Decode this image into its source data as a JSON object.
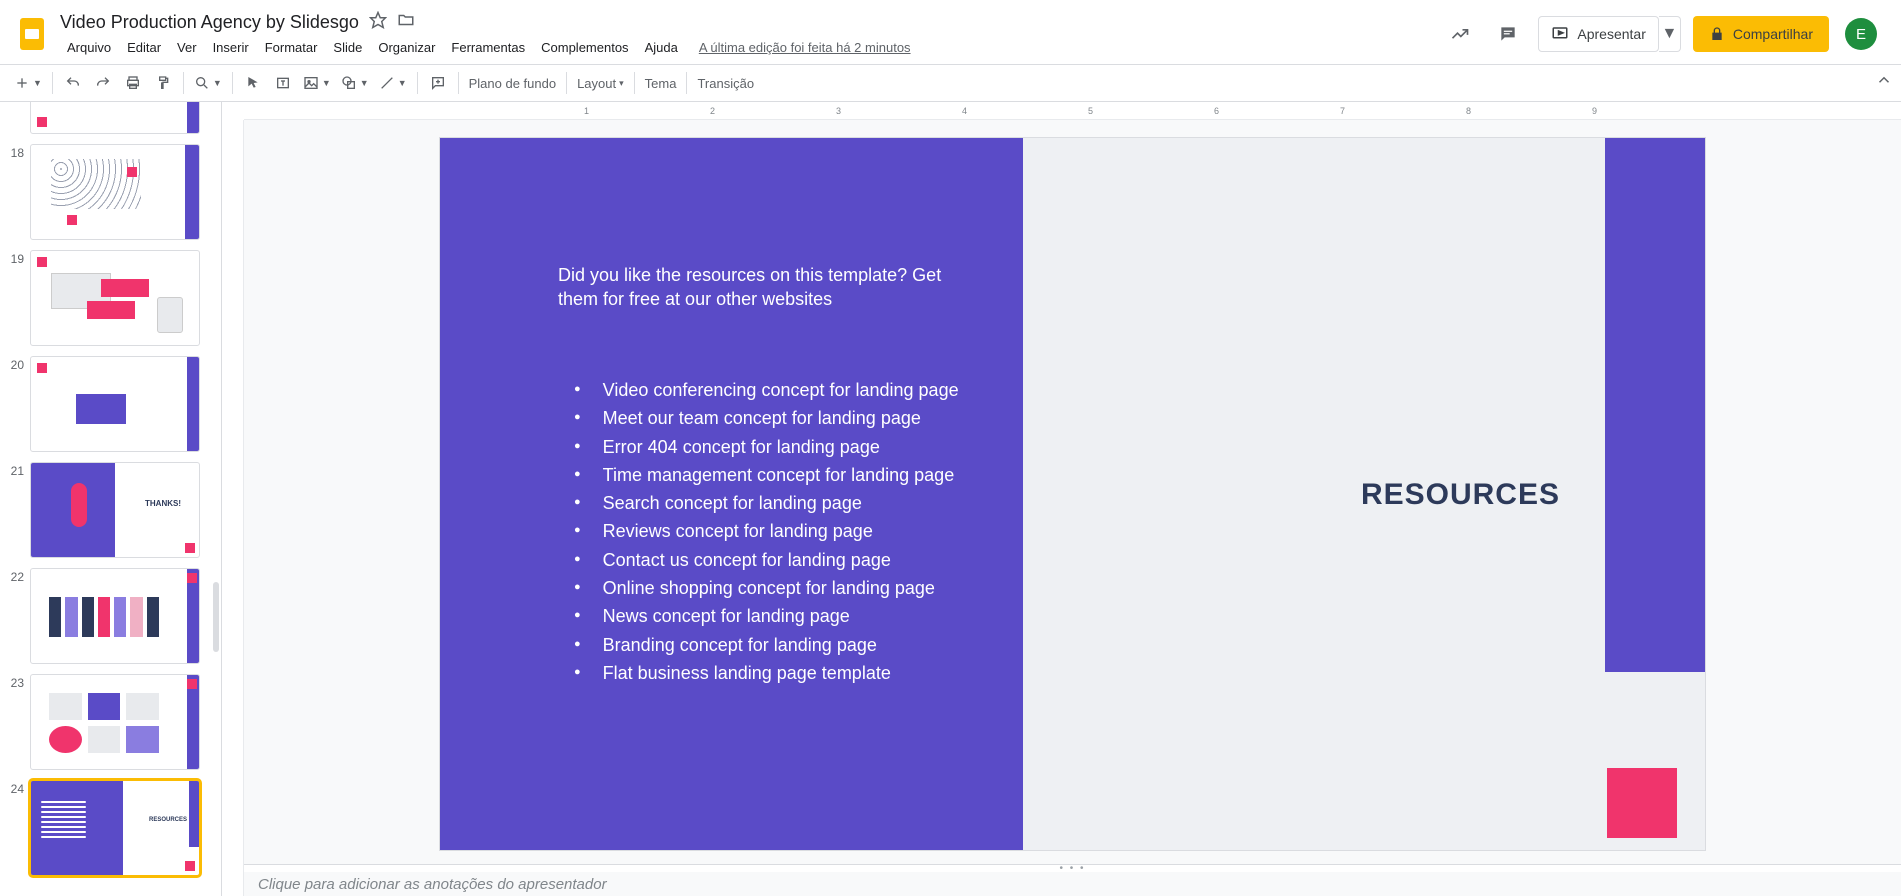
{
  "header": {
    "doc_title": "Video Production Agency by Slidesgo",
    "menu": [
      "Arquivo",
      "Editar",
      "Ver",
      "Inserir",
      "Formatar",
      "Slide",
      "Organizar",
      "Ferramentas",
      "Complementos",
      "Ajuda"
    ],
    "last_edit": "A última edição foi feita há 2 minutos",
    "present_label": "Apresentar",
    "share_label": "Compartilhar",
    "avatar_letter": "E"
  },
  "toolbar": {
    "background_label": "Plano de fundo",
    "layout_label": "Layout",
    "theme_label": "Tema",
    "transition_label": "Transição"
  },
  "filmstrip": {
    "numbers": [
      "18",
      "19",
      "20",
      "21",
      "22",
      "23",
      "24"
    ]
  },
  "slide": {
    "intro": "Did you like the resources on this template? Get them for free at our other websites",
    "heading": "RESOURCES",
    "bullets": [
      "Video conferencing concept for landing page",
      "Meet our team concept for landing page",
      "Error 404 concept for landing page",
      "Time management concept for landing page",
      "Search concept for landing page",
      "Reviews concept for landing page",
      "Contact us concept for landing page",
      "Online shopping concept for landing page",
      "News concept for landing page",
      "Branding concept for landing page",
      "Flat business landing page template"
    ]
  },
  "ruler_numbers": [
    "1",
    "2",
    "3",
    "4",
    "5",
    "6",
    "7",
    "8",
    "9"
  ],
  "notes_placeholder": "Clique para adicionar as anotações do apresentador"
}
